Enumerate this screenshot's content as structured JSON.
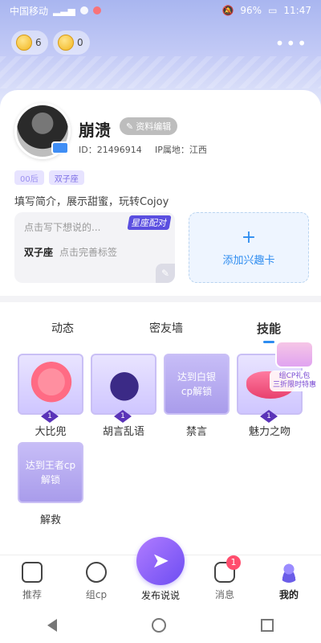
{
  "status": {
    "carrier": "中国移动",
    "battery": "96%",
    "time": "11:47"
  },
  "currency": {
    "crowns": "6",
    "coins": "0"
  },
  "profile": {
    "name": "崩溃",
    "edit_label": "资料编辑",
    "id_label": "ID：21496914",
    "ip_label": "IP属地：江西",
    "age_tag": "00后",
    "zodiac_tag": "双子座",
    "bio": "填写简介，展示甜蜜，玩转Cojoy"
  },
  "post_card": {
    "hint": "点击写下想说的...",
    "zodiac": "双子座",
    "complete_tags": "点击完善标签",
    "badge": "星座配对"
  },
  "interest_card": {
    "label": "添加兴趣卡"
  },
  "tabs": [
    "动态",
    "密友墙",
    "技能"
  ],
  "skills": [
    {
      "name": "大比兜",
      "level": "1",
      "locked": false
    },
    {
      "name": "胡言乱语",
      "level": "1",
      "locked": false
    },
    {
      "name": "禁言",
      "locked": true,
      "lock_text": "达到白银cp解锁"
    },
    {
      "name": "魅力之吻",
      "level": "1",
      "locked": false
    },
    {
      "name": "解救",
      "locked": true,
      "lock_text": "达到王者cp解锁"
    }
  ],
  "gift_promo": {
    "line1": "组CP礼包",
    "line2": "三折限时特惠"
  },
  "bottom_nav": [
    {
      "label": "推荐"
    },
    {
      "label": "组cp"
    },
    {
      "label": "发布说说"
    },
    {
      "label": "消息",
      "badge": "1"
    },
    {
      "label": "我的"
    }
  ],
  "colors": {
    "accent": "#2d8cf0",
    "purple": "#6d4df2",
    "badge": "#ff4d6d"
  }
}
